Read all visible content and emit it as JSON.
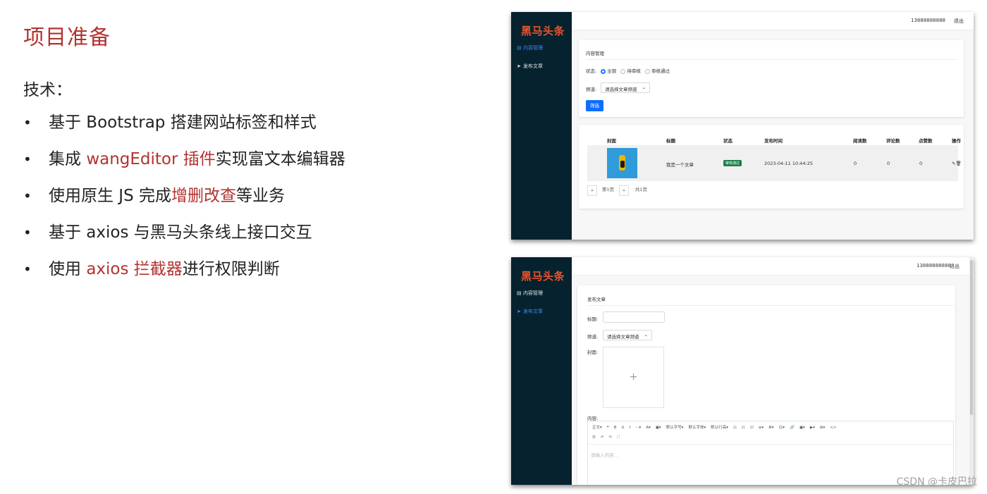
{
  "slide": {
    "title": "项目准备",
    "tech_label": "技术：",
    "bullets": [
      {
        "pre": "基于 Bootstrap 搭建网站标签和样式",
        "hl": "",
        "post": ""
      },
      {
        "pre": "集成 ",
        "hl": "wangEditor 插件",
        "post": "实现富文本编辑器"
      },
      {
        "pre": "使用原生 JS 完成",
        "hl": "增删改查",
        "post": "等业务"
      },
      {
        "pre": "基于 axios 与黑马头条线上接口交互",
        "hl": "",
        "post": ""
      },
      {
        "pre": "使用 ",
        "hl": "axios 拦截器",
        "post": "进行权限判断"
      }
    ],
    "bullet_char": "•",
    "highlight_color": "#b3322f"
  },
  "shot1": {
    "logo": "黑马头条",
    "menu": [
      {
        "label": "内容管理",
        "icon": "file-icon",
        "active": true
      },
      {
        "label": "发布文章",
        "icon": "send-icon",
        "active": false
      }
    ],
    "phone": "13888888888",
    "logout": "退出",
    "filter": {
      "title": "内容管理",
      "status_label": "状态:",
      "status_options": [
        "全部",
        "待审核",
        "审核通过"
      ],
      "channel_label": "频道:",
      "channel_placeholder": "请选择文章频道",
      "filter_button": "筛选"
    },
    "table": {
      "headers": [
        "封面",
        "标题",
        "状态",
        "发布时间",
        "阅读数",
        "评论数",
        "点赞数",
        "操作"
      ],
      "row": {
        "title": "我是一个文章",
        "status": "审核通过",
        "time": "2023-04-11 10:44:25",
        "reads": "0",
        "comments": "0",
        "likes": "0"
      }
    },
    "pager": {
      "prev": "«",
      "page": "第1页",
      "next": "»",
      "total": "共1页"
    }
  },
  "shot2": {
    "logo": "黑马头条",
    "menu": [
      {
        "label": "内容管理",
        "icon": "file-icon",
        "active": false
      },
      {
        "label": "发布文章",
        "icon": "send-icon",
        "active": true
      }
    ],
    "phone": "13888888888",
    "logout": "退出",
    "form": {
      "title": "发布文章",
      "title_label": "标题:",
      "channel_label": "频道:",
      "channel_placeholder": "请选择文章频道",
      "cover_label": "封面:",
      "cover_plus": "+",
      "content_label": "内容:",
      "editor_placeholder": "请输入内容..."
    },
    "toolbar_row1": [
      "正文▾",
      "❝",
      "B",
      "U",
      "I",
      "···▾",
      "A▾",
      "▣▾",
      "默认字号▾",
      "默认字体▾",
      "默认行高▾",
      "☷",
      "☷",
      "☑",
      "≡▾",
      "≣▾",
      "☺▾",
      "🔗",
      "▣▾",
      "▶▾",
      "⊞▾",
      "<>"
    ],
    "toolbar_row2": [
      "☰",
      "↶",
      "↷",
      "⛶"
    ]
  },
  "watermark": "CSDN @卡皮巴拉"
}
